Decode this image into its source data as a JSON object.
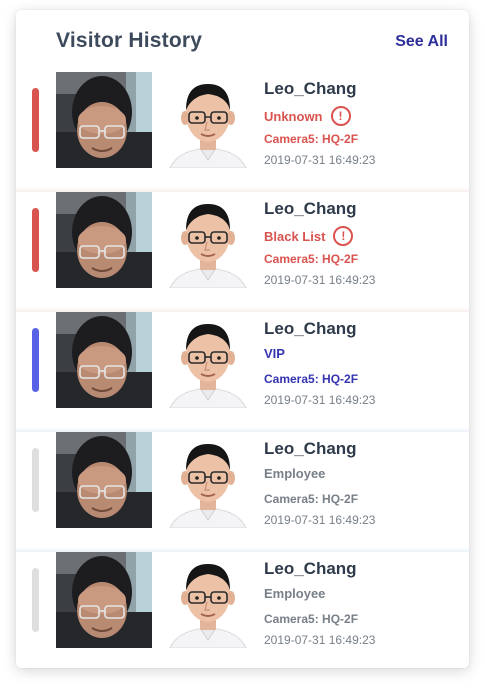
{
  "header": {
    "title": "Visitor History",
    "see_all_label": "See All"
  },
  "colors": {
    "red": "#d9534f",
    "blue": "#5862e6",
    "gray_bar": "#dedede",
    "gray_text": "#777f88",
    "vip_text": "#3534b0",
    "title": "#3d4a5c",
    "link": "#2d2f9a"
  },
  "visitors": [
    {
      "name": "Leo_Chang",
      "status": "Unknown",
      "status_icon": "alert-circle-icon",
      "camera": "Camera5: HQ-2F",
      "time": "2019-07-31 16:49:23",
      "level": "red"
    },
    {
      "name": "Leo_Chang",
      "status": "Black List",
      "status_icon": "alert-circle-icon",
      "camera": "Camera5: HQ-2F",
      "time": "2019-07-31 16:49:23",
      "level": "red"
    },
    {
      "name": "Leo_Chang",
      "status": "VIP",
      "status_icon": "",
      "camera": "Camera5: HQ-2F",
      "time": "2019-07-31 16:49:23",
      "level": "blue"
    },
    {
      "name": "Leo_Chang",
      "status": "Employee",
      "status_icon": "",
      "camera": "Camera5: HQ-2F",
      "time": "2019-07-31 16:49:23",
      "level": "gray"
    },
    {
      "name": "Leo_Chang",
      "status": "Employee",
      "status_icon": "",
      "camera": "Camera5: HQ-2F",
      "time": "2019-07-31 16:49:23",
      "level": "gray"
    }
  ]
}
